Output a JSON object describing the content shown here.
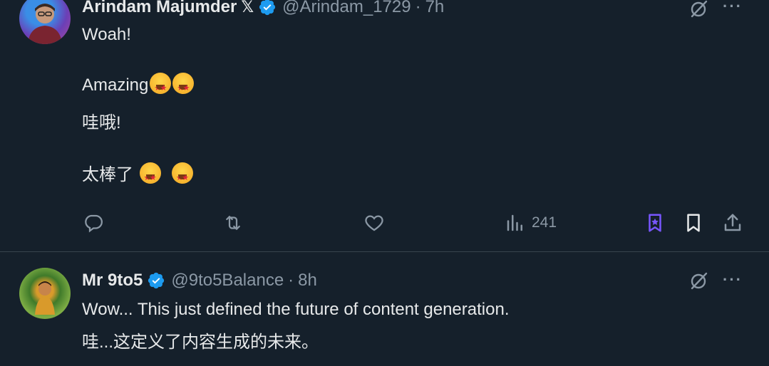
{
  "tweets": [
    {
      "author": "Arindam Majumder",
      "x_mark": "𝕏",
      "handle": "@Arindam_1729",
      "sep": "·",
      "time": "7h",
      "lines": [
        "Woah!",
        "Amazing",
        "哇哦!",
        "太棒了"
      ],
      "views": "241",
      "more": "···"
    },
    {
      "author": "Mr 9to5",
      "handle": "@9to5Balance",
      "sep": "·",
      "time": "8h",
      "lines": [
        "Wow... This just defined the future of content generation.",
        "哇...这定义了内容生成的未来。"
      ],
      "more": "···"
    }
  ],
  "icons": {
    "verified": "verified-badge-icon",
    "grok": "grok-icon",
    "reply": "reply-icon",
    "retweet": "retweet-icon",
    "like": "heart-icon",
    "views": "views-icon",
    "bookmark_special": "bookmark-star-icon",
    "bookmark": "bookmark-icon",
    "share": "share-icon"
  },
  "colors": {
    "background": "#15202b",
    "text": "#e7e9ea",
    "secondary": "#8b98a5",
    "verified": "#1d9bf0",
    "accent_purple": "#7856ff",
    "divider": "#38444d"
  }
}
